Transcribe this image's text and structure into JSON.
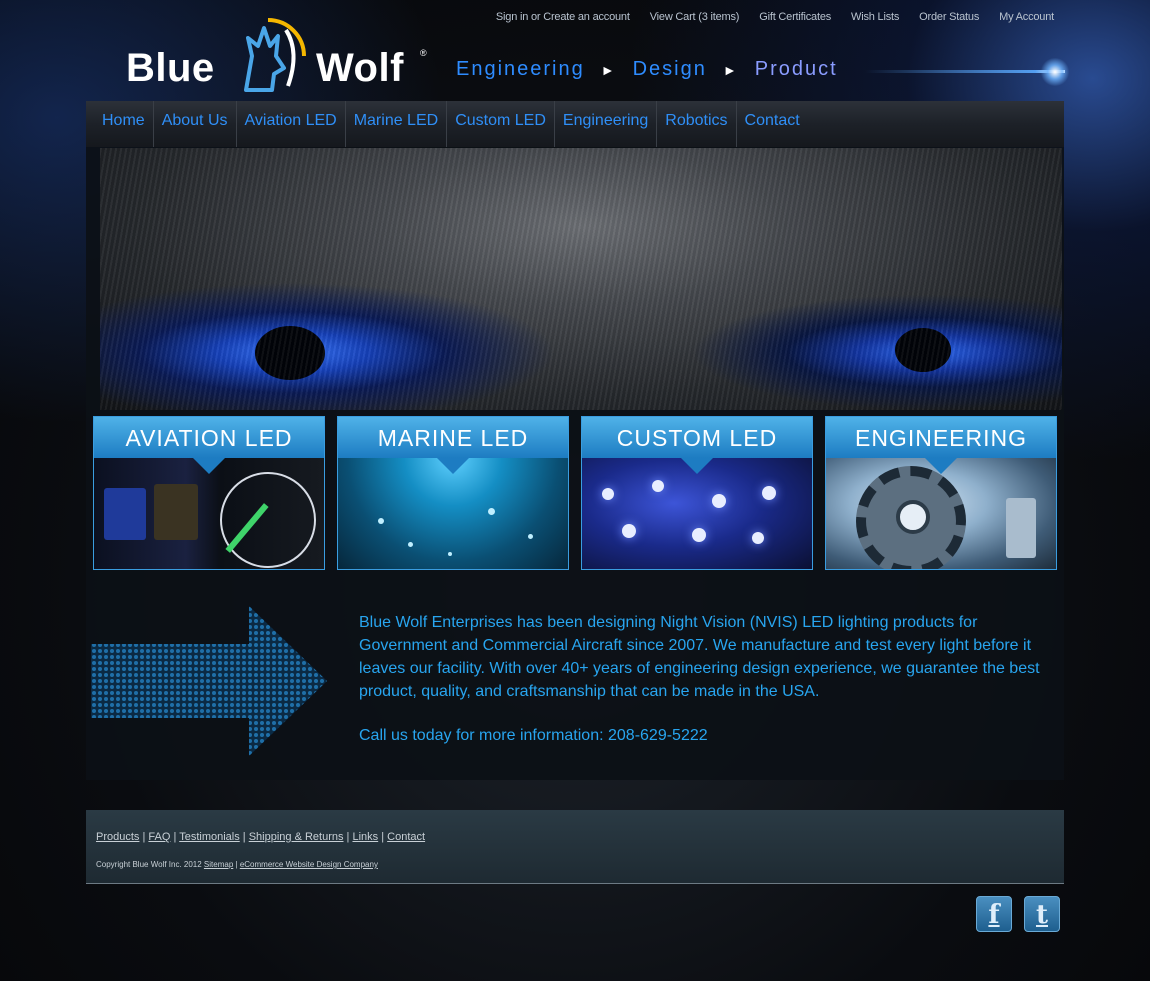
{
  "top_links": [
    "Sign in or Create an account",
    "View Cart (3 items)",
    "Gift Certificates",
    "Wish Lists",
    "Order Status",
    "My Account"
  ],
  "logo": {
    "word1": "Blue",
    "word2": "Wolf",
    "reg": "®"
  },
  "tagline": {
    "engineering": "Engineering",
    "design": "Design",
    "product": "Product"
  },
  "nav": [
    "Home",
    "About Us",
    "Aviation LED",
    "Marine LED",
    "Custom LED",
    "Engineering",
    "Robotics",
    "Contact"
  ],
  "tiles": [
    "AVIATION LED",
    "MARINE LED",
    "CUSTOM LED",
    "ENGINEERING"
  ],
  "intro": "Blue Wolf Enterprises has been designing Night Vision (NVIS) LED lighting products for Government and Commercial Aircraft since 2007. We manufacture and test every light before it leaves our facility. With over 40+ years of engineering design experience, we guarantee the best product, quality, and craftsmanship that can be made in the USA.",
  "call": "Call us today for more information: 208-629-5222",
  "footer": {
    "links": [
      "Products",
      "FAQ",
      "Testimonials",
      "Shipping & Returns",
      "Links",
      "Contact"
    ],
    "copyright": "Copyright Blue Wolf Inc. 2012",
    "sitemap": "Sitemap",
    "design": "eCommerce Website Design Company"
  },
  "social": {
    "facebook": "f",
    "twitter": "t"
  },
  "colors": {
    "accent": "#2f8ff7",
    "text_blue": "#28a5ef",
    "tile_blue": "#1d7cc2"
  }
}
